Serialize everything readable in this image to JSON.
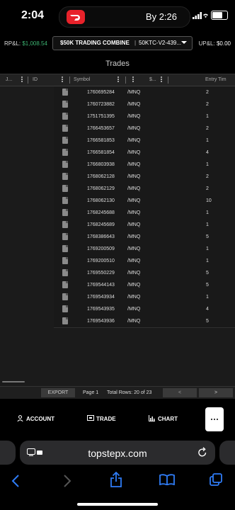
{
  "status_bar": {
    "time": "2:04",
    "activity": "By 2:26"
  },
  "header": {
    "rpl_label": "RP&L:",
    "rpl_value": "$1,008.54",
    "account_name": "$50K TRADING COMBINE",
    "account_separator": "|",
    "account_id": "50KTC-V2-439...",
    "upl_label": "UP&L:",
    "upl_value": "$0.00",
    "rpl_color": "#3cb371"
  },
  "page_title": "Trades",
  "grid": {
    "columns": [
      "J...",
      "ID",
      "Symbol",
      "$...",
      "Entry Tim"
    ],
    "rows": [
      {
        "id": "1760695284",
        "symbol": "/MNQ",
        "qty": "2"
      },
      {
        "id": "1760723882",
        "symbol": "/MNQ",
        "qty": "2"
      },
      {
        "id": "1751751395",
        "symbol": "/MNQ",
        "qty": "1"
      },
      {
        "id": "1766453657",
        "symbol": "/MNQ",
        "qty": "2"
      },
      {
        "id": "1766581853",
        "symbol": "/MNQ",
        "qty": "1"
      },
      {
        "id": "1766581854",
        "symbol": "/MNQ",
        "qty": "4"
      },
      {
        "id": "1766803938",
        "symbol": "/MNQ",
        "qty": "1"
      },
      {
        "id": "1768062128",
        "symbol": "/MNQ",
        "qty": "2"
      },
      {
        "id": "1768062129",
        "symbol": "/MNQ",
        "qty": "2"
      },
      {
        "id": "1768062130",
        "symbol": "/MNQ",
        "qty": "10"
      },
      {
        "id": "1768245688",
        "symbol": "/MNQ",
        "qty": "1"
      },
      {
        "id": "1768245689",
        "symbol": "/MNQ",
        "qty": "1"
      },
      {
        "id": "1768386643",
        "symbol": "/MNQ",
        "qty": "5"
      },
      {
        "id": "1769200509",
        "symbol": "/MNQ",
        "qty": "1"
      },
      {
        "id": "1769200510",
        "symbol": "/MNQ",
        "qty": "1"
      },
      {
        "id": "1769550229",
        "symbol": "/MNQ",
        "qty": "5"
      },
      {
        "id": "1769544143",
        "symbol": "/MNQ",
        "qty": "5"
      },
      {
        "id": "1769543934",
        "symbol": "/MNQ",
        "qty": "1"
      },
      {
        "id": "1769543935",
        "symbol": "/MNQ",
        "qty": "4"
      },
      {
        "id": "1769543936",
        "symbol": "/MNQ",
        "qty": "5"
      }
    ]
  },
  "footer": {
    "export_label": "EXPORT",
    "page_label": "Page 1",
    "total_label": "Total Rows: 20 of 23",
    "prev_label": "<",
    "next_label": ">"
  },
  "bottom_nav": {
    "account": "ACCOUNT",
    "trade": "TRADE",
    "chart": "CHART",
    "more_icon": "ellipsis-icon"
  },
  "browser": {
    "url": "topstepx.com"
  }
}
